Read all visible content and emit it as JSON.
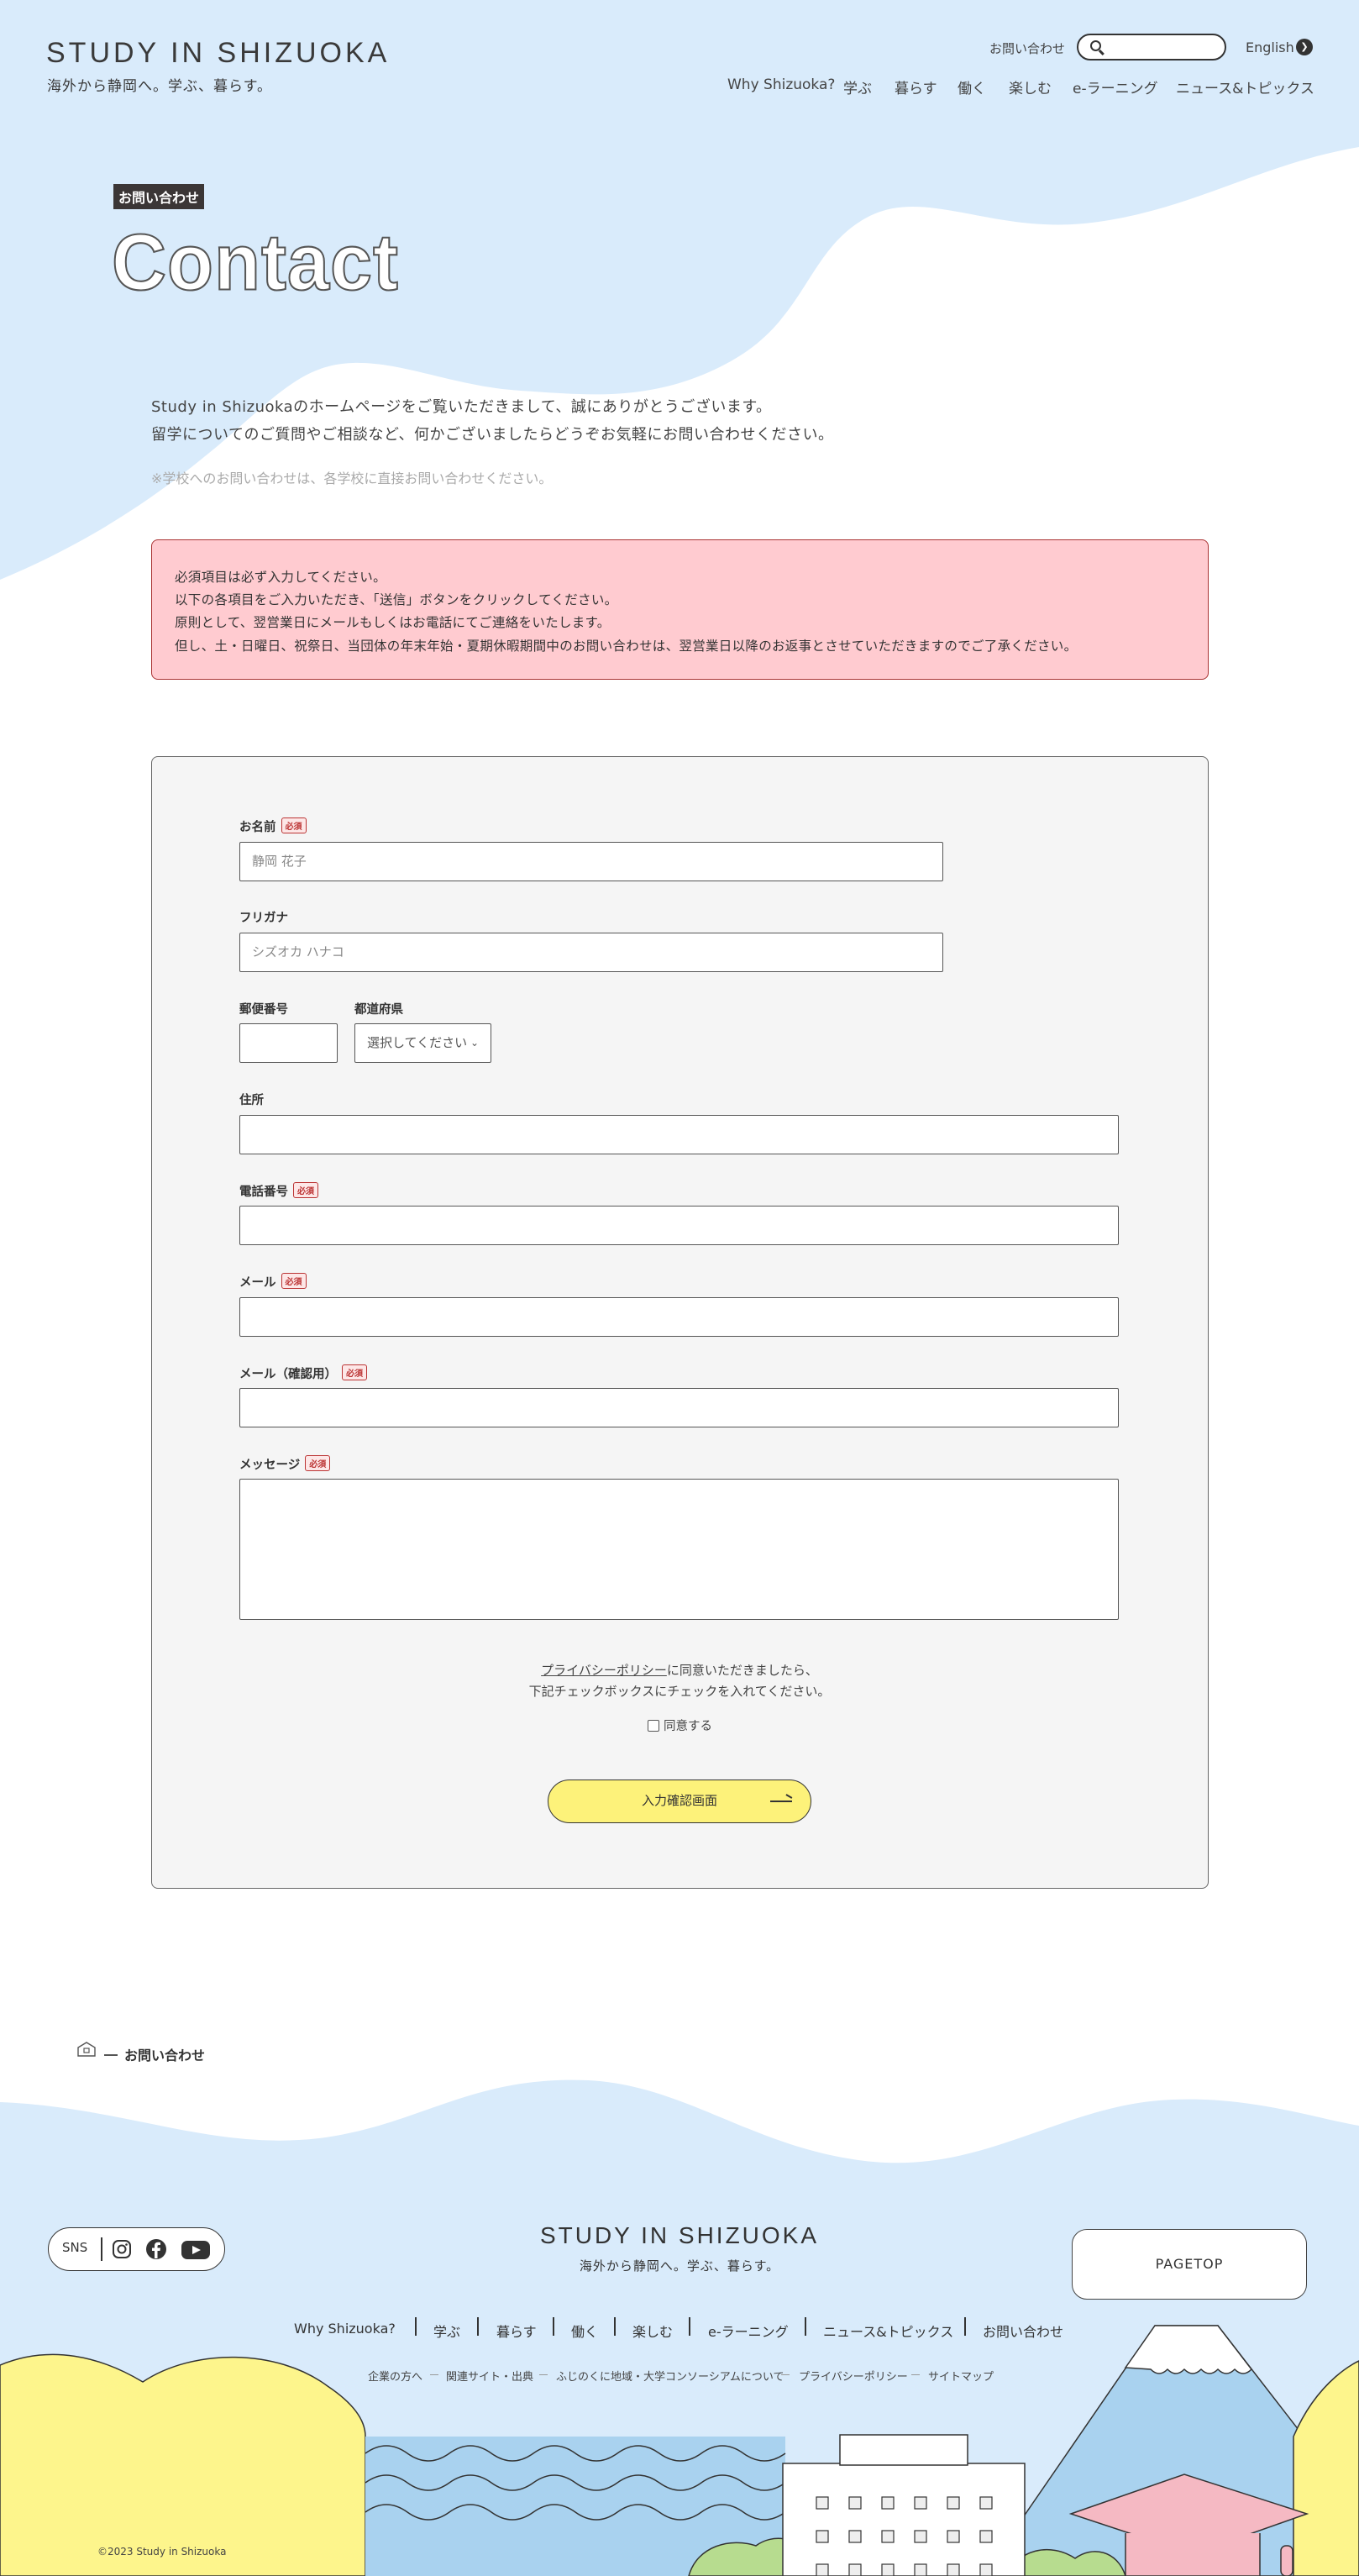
{
  "header": {
    "logo": "STUDY IN SHIZUOKA",
    "tagline": "海外から静岡へ。学ぶ、暮らす。",
    "contact_link": "お問い合わせ",
    "search": {
      "placeholder": ""
    },
    "language": "English",
    "nav": [
      "Why Shizuoka?",
      "学ぶ",
      "暮らす",
      "働く",
      "楽しむ",
      "e-ラーニング",
      "ニュース&トピックス"
    ]
  },
  "hero": {
    "badge": "お問い合わせ",
    "title": "Contact"
  },
  "intro": {
    "lines": [
      "Study in Shizuokaのホームページをご覧いただきまして、誠にありがとうございます。",
      "留学についてのご質問やご相談など、何かございましたらどうぞお気軽にお問い合わせください。"
    ],
    "note": "※学校へのお問い合わせは、各学校に直接お問い合わせください。"
  },
  "notice": {
    "lines": [
      "必須項目は必ず入力してください。",
      "以下の各項目をご入力いただき、「送信」ボタンをクリックしてください。",
      "原則として、翌営業日にメールもしくはお電話にてご連絡をいたします。",
      "但し、土・日曜日、祝祭日、当団体の年末年始・夏期休暇期間中のお問い合わせは、翌営業日以降のお返事とさせていただきますのでご了承ください。"
    ]
  },
  "form": {
    "required_badge": "必須",
    "name": {
      "label": "お名前",
      "placeholder": "静岡 花子"
    },
    "kana": {
      "label": "フリガナ",
      "placeholder": "シズオカ ハナコ"
    },
    "postal": {
      "label": "郵便番号",
      "value": ""
    },
    "prefecture": {
      "label": "都道府県",
      "selected": "選択してください"
    },
    "address": {
      "label": "住所",
      "value": ""
    },
    "phone": {
      "label": "電話番号",
      "value": ""
    },
    "email": {
      "label": "メール",
      "value": ""
    },
    "email_confirm": {
      "label": "メール（確認用）",
      "value": ""
    },
    "message": {
      "label": "メッセージ",
      "value": ""
    },
    "privacy_link": "プライバシーポリシー",
    "privacy_text1": "に同意いただきましたら、",
    "privacy_text2": "下記チェックボックスにチェックを入れてください。",
    "agree_label": "同意する",
    "submit_label": "入力確認画面"
  },
  "breadcrumb": {
    "current": "お問い合わせ"
  },
  "footer": {
    "sns_label": "SNS",
    "logo": "STUDY IN SHIZUOKA",
    "tagline": "海外から静岡へ。学ぶ、暮らす。",
    "nav": [
      "Why Shizuoka?",
      "学ぶ",
      "暮らす",
      "働く",
      "楽しむ",
      "e-ラーニング",
      "ニュース&トピックス",
      "お問い合わせ"
    ],
    "subnav": [
      "企業の方へ",
      "関連サイト・出典",
      "ふじのくに地域・大学コンソーシアムについて",
      "プライバシーポリシー",
      "サイトマップ"
    ],
    "pagetop": "PAGETOP",
    "copyright": "©2023 Study in Shizuoka"
  },
  "colors": {
    "sky": "#d9ebfb",
    "notice_bg": "#ffcbd0",
    "button_yellow": "#fdf27a",
    "panel_bg": "#f5f5f5"
  }
}
